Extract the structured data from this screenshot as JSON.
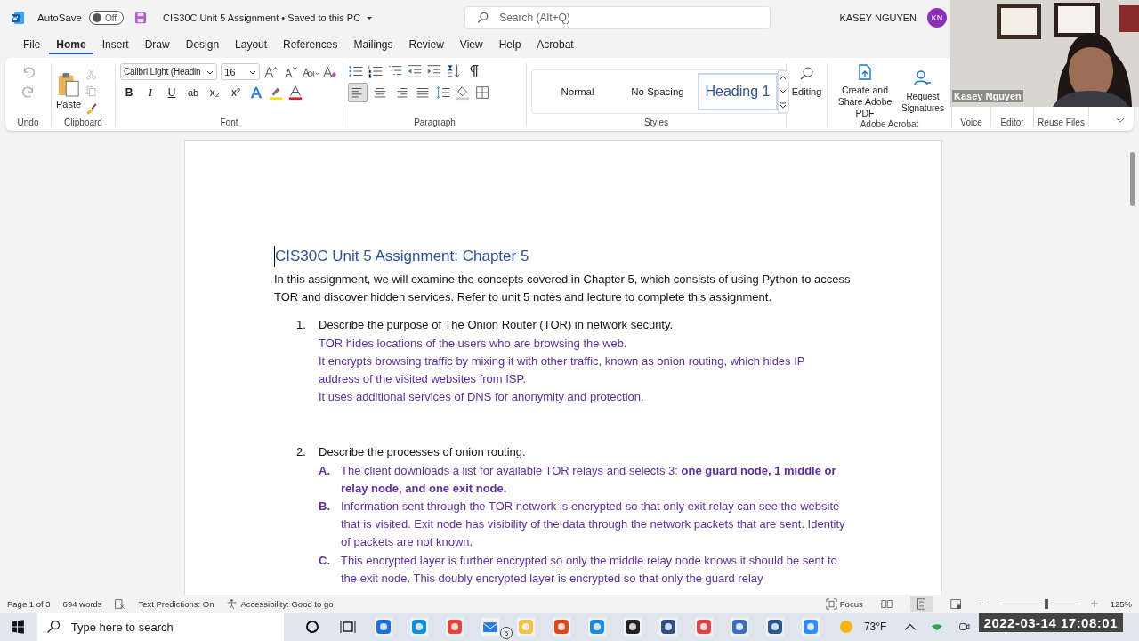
{
  "titlebar": {
    "autosave_label": "AutoSave",
    "autosave_on": false,
    "autosave_state": "Off",
    "doc_title": "CIS30C Unit 5 Assignment • Saved to this PC",
    "search_placeholder": "Search (Alt+Q)",
    "user_name": "KASEY NGUYEN",
    "user_initials": "KN"
  },
  "menu_tabs": [
    {
      "label": "File",
      "selected": false
    },
    {
      "label": "Home",
      "selected": true
    },
    {
      "label": "Insert",
      "selected": false
    },
    {
      "label": "Draw",
      "selected": false
    },
    {
      "label": "Design",
      "selected": false
    },
    {
      "label": "Layout",
      "selected": false
    },
    {
      "label": "References",
      "selected": false
    },
    {
      "label": "Mailings",
      "selected": false
    },
    {
      "label": "Review",
      "selected": false
    },
    {
      "label": "View",
      "selected": false
    },
    {
      "label": "Help",
      "selected": false
    },
    {
      "label": "Acrobat",
      "selected": false
    }
  ],
  "ribbon": {
    "paste_label": "Paste",
    "font_name": "Calibri Light (Headin",
    "font_size": "16",
    "format_buttons": [
      "B",
      "I",
      "U",
      "ab",
      "x₂",
      "x²"
    ],
    "alignments": [
      {
        "selected": true
      },
      {
        "selected": false
      },
      {
        "selected": false
      },
      {
        "selected": false
      }
    ],
    "styles": [
      {
        "label": "Normal",
        "selected": false
      },
      {
        "label": "No Spacing",
        "selected": false
      },
      {
        "label": "Heading 1",
        "selected": true
      }
    ],
    "editing": "Editing",
    "acrobat": [
      {
        "label": "Create and Share Adobe PDF"
      },
      {
        "label": "Request Signatures"
      }
    ],
    "groups": [
      "Undo",
      "Clipboard",
      "Font",
      "Paragraph",
      "Styles",
      "Adobe Acrobat",
      "Voice",
      "Editor",
      "Reuse Files"
    ]
  },
  "document": {
    "title": "CIS30C Unit 5 Assignment: Chapter 5",
    "intro": "In this assignment, we will examine the concepts covered in Chapter 5, which consists of using Python to access TOR and discover hidden services. Refer to unit 5 notes and lecture to complete this assignment.",
    "questions": [
      {
        "number": "1.",
        "prompt": "Describe the purpose of The Onion Router (TOR) in network security.",
        "answers": [
          "TOR hides locations of the users who are browsing the web.",
          "It encrypts browsing traffic by mixing it with other traffic, known as onion routing, which hides IP address of the visited websites from ISP.",
          "It uses additional services of DNS for anonymity and protection."
        ]
      },
      {
        "number": "2.",
        "prompt": "Describe the processes of onion routing.",
        "steps": [
          {
            "letter": "A.",
            "text": "The client downloads a list for available TOR relays and selects 3: **one guard node, 1 middle or relay node, and one exit node.**"
          },
          {
            "letter": "B.",
            "text": "Information sent through the TOR network is encrypted so that only exit relay can see the website that is visited. Exit node has visibility of the data through the network packets that are sent. Identity of packets are not known."
          },
          {
            "letter": "C.",
            "text": "This encrypted layer is further encrypted so only the middle relay node knows it should be sent to the exit node. This doubly encrypted layer is encrypted so that only the guard relay"
          }
        ]
      }
    ]
  },
  "status_bar": {
    "page": "Page 1 of 3",
    "words": "694 words",
    "predictions": "Text Predictions: On",
    "accessibility": "Accessibility: Good to go",
    "focus": "Focus",
    "zoom": "125%",
    "level": 0.6
  },
  "taskbar": {
    "search_placeholder": "Type here to search",
    "mail_badge": "5",
    "weather": "73°F"
  },
  "video": {
    "kind": "picture",
    "name": "Kasey Nguyen"
  },
  "timestamp": "2022-03-14 17:08:01"
}
